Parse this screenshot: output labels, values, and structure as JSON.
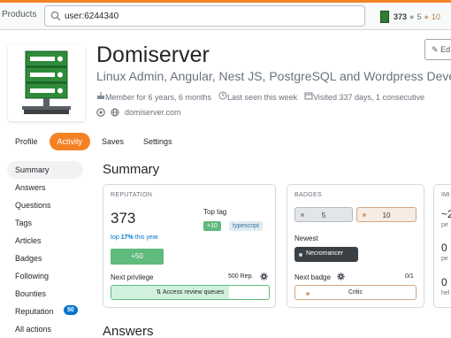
{
  "topbar": {
    "products_label": "Products",
    "search_value": "user:6244340",
    "reputation": "373",
    "silver_badges": "5",
    "bronze_badges": "10"
  },
  "profile": {
    "name": "Domiserver",
    "title": "Linux Admin, Angular, Nest JS, PostgreSQL and Wordpress Deve",
    "member_for": "Member for 6 years, 6 months",
    "last_seen": "Last seen this week",
    "visited": "Visited 337 days, 1 consecutive",
    "website": "domiserver.com",
    "edit_label": "Ed"
  },
  "tabs": [
    {
      "label": "Profile"
    },
    {
      "label": "Activity",
      "active": true
    },
    {
      "label": "Saves"
    },
    {
      "label": "Settings"
    }
  ],
  "sidebar": {
    "items": [
      {
        "label": "Summary"
      },
      {
        "label": "Answers"
      },
      {
        "label": "Questions"
      },
      {
        "label": "Tags"
      },
      {
        "label": "Articles"
      },
      {
        "label": "Badges"
      },
      {
        "label": "Following"
      },
      {
        "label": "Bounties"
      },
      {
        "label": "Reputation",
        "badge": "50"
      },
      {
        "label": "All actions"
      }
    ]
  },
  "summary": {
    "heading": "Summary",
    "reputation": {
      "caption": "REPUTATION",
      "value": "373",
      "top_prefix": "top",
      "top_percent": "17%",
      "top_suffix": "this year",
      "recent_gain": "+50",
      "top_tag_label": "Top tag",
      "top_tag_score": "+10",
      "top_tag_name": "typescript",
      "next_privilege_label": "Next privilege",
      "next_privilege_rep": "500 Rep.",
      "next_privilege_name": "Access review queues",
      "next_privilege_progress": 0.746
    },
    "badges": {
      "caption": "BADGES",
      "silver": "5",
      "bronze": "10",
      "newest_label": "Newest",
      "newest_name": "Necromancer",
      "next_badge_label": "Next badge",
      "next_badge_count": "0/1",
      "next_badge_name": "Critic"
    },
    "impact": {
      "caption": "IMI",
      "rows": [
        {
          "value": "~2",
          "sub": "pe"
        },
        {
          "value": "0",
          "sub": "pe"
        },
        {
          "value": "0",
          "sub": "hel"
        }
      ]
    }
  },
  "answers_heading": "Answers",
  "colors": {
    "accent": "#f48225",
    "link": "#0074cc",
    "green": "#5eba7d",
    "silver": "#9a9fa5",
    "bronze": "#d1a684"
  }
}
